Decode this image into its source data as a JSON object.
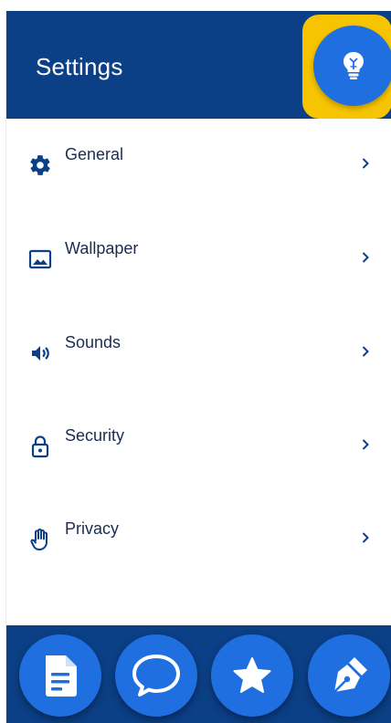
{
  "header": {
    "title": "Settings"
  },
  "tip_button": {
    "icon": "lightbulb-icon"
  },
  "menu": {
    "items": [
      {
        "label": "General",
        "icon": "gear-icon"
      },
      {
        "label": "Wallpaper",
        "icon": "image-icon"
      },
      {
        "label": "Sounds",
        "icon": "speaker-icon"
      },
      {
        "label": "Security",
        "icon": "lock-icon"
      },
      {
        "label": "Privacy",
        "icon": "hand-icon"
      }
    ]
  },
  "bottom_nav": {
    "buttons": [
      {
        "icon": "document-icon"
      },
      {
        "icon": "chat-bubble-icon"
      },
      {
        "icon": "star-icon"
      },
      {
        "icon": "pen-nib-icon"
      }
    ]
  },
  "colors": {
    "primary_dark": "#0b3f86",
    "accent_blue": "#1f6fe0",
    "highlight_yellow": "#f6c400",
    "text_dark": "#1b2b52"
  }
}
